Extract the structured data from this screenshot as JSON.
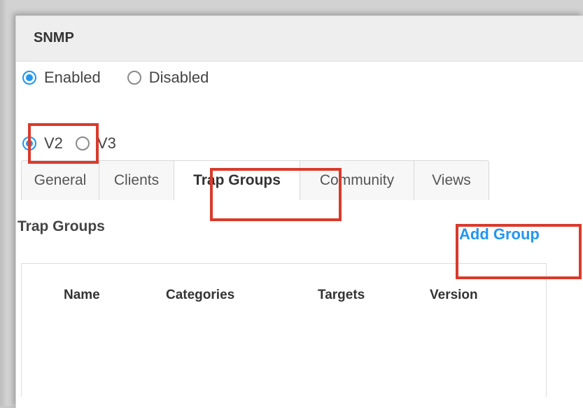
{
  "panel": {
    "title": "SNMP"
  },
  "status_radio": {
    "options": [
      {
        "label": "Enabled",
        "checked": true
      },
      {
        "label": "Disabled",
        "checked": false
      }
    ]
  },
  "version_radio": {
    "options": [
      {
        "label": "V2",
        "checked": true
      },
      {
        "label": "V3",
        "checked": false
      }
    ]
  },
  "tabs": [
    {
      "label": "General",
      "active": false
    },
    {
      "label": "Clients",
      "active": false
    },
    {
      "label": "Trap Groups",
      "active": true
    },
    {
      "label": "Community",
      "active": false
    },
    {
      "label": "Views",
      "active": false
    }
  ],
  "section": {
    "title": "Trap Groups",
    "add_label": "Add Group"
  },
  "table": {
    "columns": [
      "Name",
      "Categories",
      "Targets",
      "Version"
    ],
    "rows": []
  },
  "colors": {
    "accent": "#2196f3",
    "highlight": "#d93a2b",
    "header_bg": "#eeeeee"
  }
}
